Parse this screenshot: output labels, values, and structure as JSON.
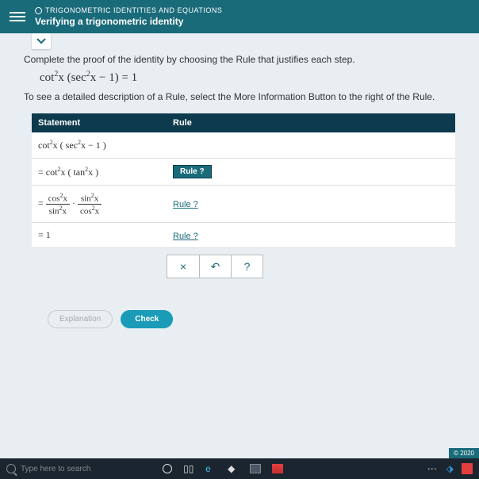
{
  "header": {
    "category": "TRIGONOMETRIC IDENTITIES AND EQUATIONS",
    "topic": "Verifying a trigonometric identity"
  },
  "content": {
    "instruction1": "Complete the proof of the identity by choosing the Rule that justifies each step.",
    "identity_lhs": "cot",
    "identity_expr": "x (sec",
    "identity_tail": "x − 1) = 1",
    "instruction2": "To see a detailed description of a Rule, select the More Information Button to the right of the Rule."
  },
  "table": {
    "header_statement": "Statement",
    "header_rule": "Rule",
    "rows": [
      {
        "rule": ""
      },
      {
        "rule_selected": "Rule ?"
      },
      {
        "rule_link": "Rule ?"
      },
      {
        "rule_link": "Rule ?"
      }
    ]
  },
  "actions": {
    "close": "×",
    "undo": "↶",
    "help": "?"
  },
  "buttons": {
    "explanation": "Explanation",
    "check": "Check"
  },
  "copyright": "© 2020",
  "taskbar": {
    "search_placeholder": "Type here to search"
  }
}
